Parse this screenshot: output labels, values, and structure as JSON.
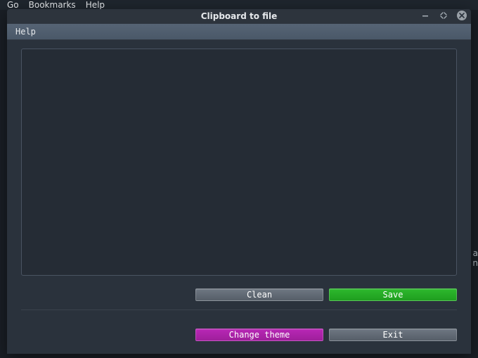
{
  "bg_menu": {
    "go": "Go",
    "bookmarks": "Bookmarks",
    "help": "Help"
  },
  "bg_frag": {
    "a": "a",
    "n": "n"
  },
  "window": {
    "title": "Clipboard to file",
    "menu": {
      "help": "Help"
    },
    "textarea_value": "",
    "buttons": {
      "clean": "Clean",
      "save": "Save",
      "change_theme": "Change theme",
      "exit": "Exit"
    }
  }
}
